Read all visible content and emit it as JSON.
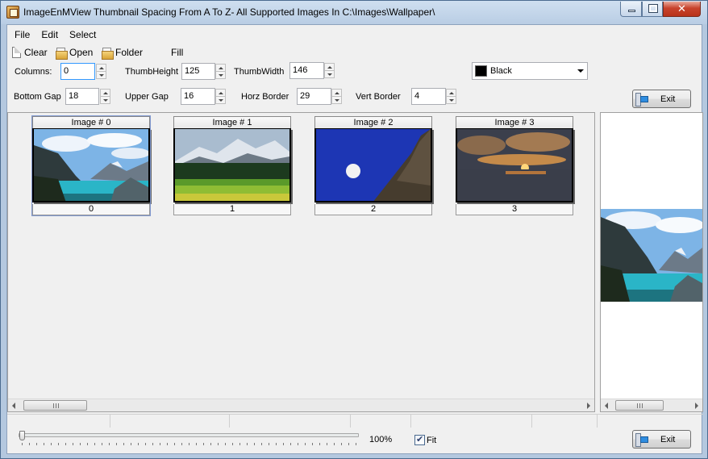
{
  "window": {
    "title": "ImageEnMView Thumbnail Spacing From A To Z- All Supported Images In C:\\Images\\Wallpaper\\"
  },
  "menu": [
    "File",
    "Edit",
    "Select"
  ],
  "toolbar": {
    "clear": "Clear",
    "open": "Open",
    "folder": "Folder",
    "fill": "Fill"
  },
  "fields": {
    "columns": {
      "label": "Columns:",
      "value": "0"
    },
    "thumb_height": {
      "label": "ThumbHeight",
      "value": "125"
    },
    "thumb_width": {
      "label": "ThumbWidth",
      "value": "146"
    },
    "bottom_gap": {
      "label": "Bottom Gap",
      "value": "18"
    },
    "upper_gap": {
      "label": "Upper Gap",
      "value": "16"
    },
    "horz_border": {
      "label": "Horz Border",
      "value": "29"
    },
    "vert_border": {
      "label": "Vert Border",
      "value": "4"
    }
  },
  "background_color": {
    "label": "Black",
    "swatch": "#000000"
  },
  "buttons": {
    "exit_top": "Exit",
    "exit_bottom": "Exit"
  },
  "thumbnails": [
    {
      "title": "Image # 0",
      "caption": "0"
    },
    {
      "title": "Image # 1",
      "caption": "1"
    },
    {
      "title": "Image # 2",
      "caption": "2"
    },
    {
      "title": "Image # 3",
      "caption": "3"
    }
  ],
  "zoom": {
    "value": "100%",
    "slider_fraction": 0
  },
  "fit": {
    "label": "Fit",
    "checked": true
  }
}
